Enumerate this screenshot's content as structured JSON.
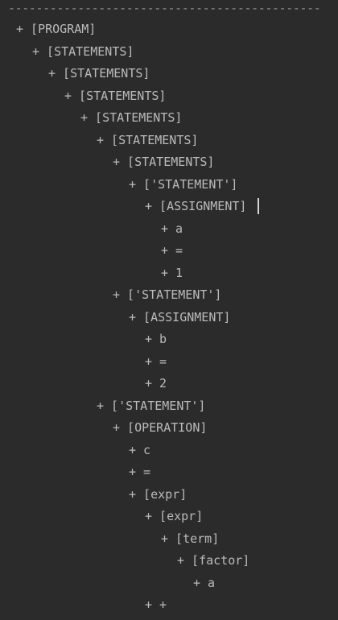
{
  "console": {
    "separator": "---------------------------------------------",
    "lines": [
      {
        "depth": 0,
        "text": "+ [PROGRAM]"
      },
      {
        "depth": 1,
        "text": "+ [STATEMENTS]"
      },
      {
        "depth": 2,
        "text": "+ [STATEMENTS]"
      },
      {
        "depth": 3,
        "text": "+ [STATEMENTS]"
      },
      {
        "depth": 4,
        "text": "+ [STATEMENTS]"
      },
      {
        "depth": 5,
        "text": "+ [STATEMENTS]"
      },
      {
        "depth": 6,
        "text": "+ [STATEMENTS]"
      },
      {
        "depth": 7,
        "text": "+ ['STATEMENT']"
      },
      {
        "depth": 8,
        "text": "+ [ASSIGNMENT]"
      },
      {
        "depth": 9,
        "text": "+ a"
      },
      {
        "depth": 9,
        "text": "+ ="
      },
      {
        "depth": 9,
        "text": "+ 1"
      },
      {
        "depth": 6,
        "text": "+ ['STATEMENT']"
      },
      {
        "depth": 7,
        "text": "+ [ASSIGNMENT]"
      },
      {
        "depth": 8,
        "text": "+ b"
      },
      {
        "depth": 8,
        "text": "+ ="
      },
      {
        "depth": 8,
        "text": "+ 2"
      },
      {
        "depth": 5,
        "text": "+ ['STATEMENT']"
      },
      {
        "depth": 6,
        "text": "+ [OPERATION]"
      },
      {
        "depth": 7,
        "text": "+ c"
      },
      {
        "depth": 7,
        "text": "+ ="
      },
      {
        "depth": 7,
        "text": "+ [expr]"
      },
      {
        "depth": 8,
        "text": "+ [expr]"
      },
      {
        "depth": 9,
        "text": "+ [term]"
      },
      {
        "depth": 10,
        "text": "+ [factor]"
      },
      {
        "depth": 11,
        "text": "+ a"
      },
      {
        "depth": 8,
        "text": "+ +"
      }
    ]
  },
  "colors": {
    "background": "#2b2b2b",
    "text": "#bbbbbb",
    "separator": "#8c8c8c",
    "caret": "#d4d4d4"
  }
}
